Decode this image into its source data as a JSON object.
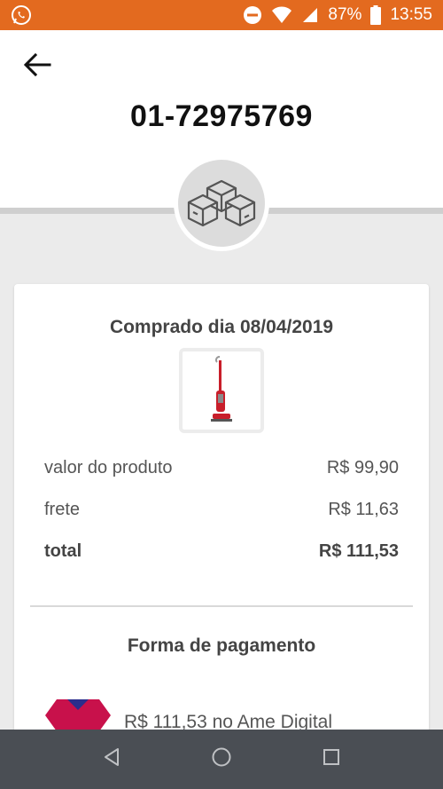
{
  "status_bar": {
    "battery": "87%",
    "time": "13:55"
  },
  "header": {
    "order_id": "01-72975769"
  },
  "card": {
    "purchase_date": "Comprado dia 08/04/2019",
    "rows": [
      {
        "label": "valor do produto",
        "value": "R$ 99,90"
      },
      {
        "label": "frete",
        "value": "R$ 11,63"
      },
      {
        "label": "total",
        "value": "R$ 111,53"
      }
    ],
    "payment_title": "Forma de pagamento",
    "payment_text": "R$ 111,53 no Ame Digital"
  },
  "colors": {
    "status_bar": "#e36a1f",
    "nav_bar": "#4a4e54",
    "payment_icon": "#c8114b"
  },
  "icons": [
    "whatsapp-icon",
    "dnd-icon",
    "wifi-icon",
    "signal-icon",
    "battery-icon",
    "back-arrow-icon",
    "boxes-icon",
    "product-vacuum-image",
    "ame-digital-icon",
    "nav-back-icon",
    "nav-home-icon",
    "nav-recents-icon"
  ]
}
